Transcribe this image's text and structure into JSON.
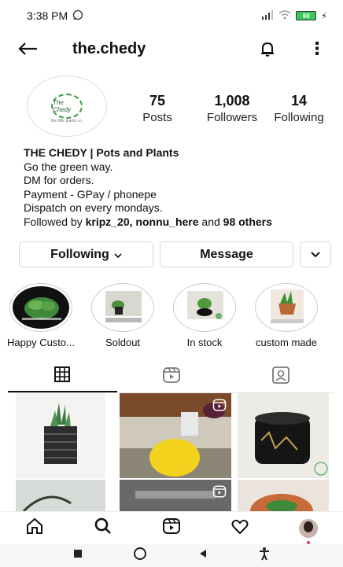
{
  "status_bar": {
    "time": "3:38 PM",
    "battery": "60"
  },
  "header": {
    "username": "the.chedy"
  },
  "profile": {
    "avatar_text": "The Chedy",
    "avatar_tag": "the little plants co.",
    "stats": [
      {
        "value": "75",
        "label": "Posts"
      },
      {
        "value": "1,008",
        "label": "Followers"
      },
      {
        "value": "14",
        "label": "Following"
      }
    ],
    "bio": {
      "name": "THE CHEDY | Pots and Plants",
      "lines": [
        "Go the green way.",
        "DM for orders.",
        "Payment - GPay / phonepe",
        "Dispatch on every mondays."
      ],
      "followed_prefix": "Followed by ",
      "followed_users": "kripz_20, nonnu_here",
      "followed_mid": " and ",
      "followed_others": "98 others"
    }
  },
  "actions": {
    "following_label": "Following",
    "message_label": "Message"
  },
  "highlights": [
    {
      "label": "Happy Custo..."
    },
    {
      "label": "Soldout"
    },
    {
      "label": "In stock"
    },
    {
      "label": "custom made"
    }
  ],
  "tabs": [
    "grid-icon",
    "reels-icon",
    "tagged-icon"
  ],
  "nav": [
    "home-icon",
    "search-icon",
    "reels-icon",
    "heart-icon",
    "profile-avatar"
  ],
  "colors": {
    "accent_green": "#3b9a46",
    "notification_dot": "#e1306c"
  }
}
